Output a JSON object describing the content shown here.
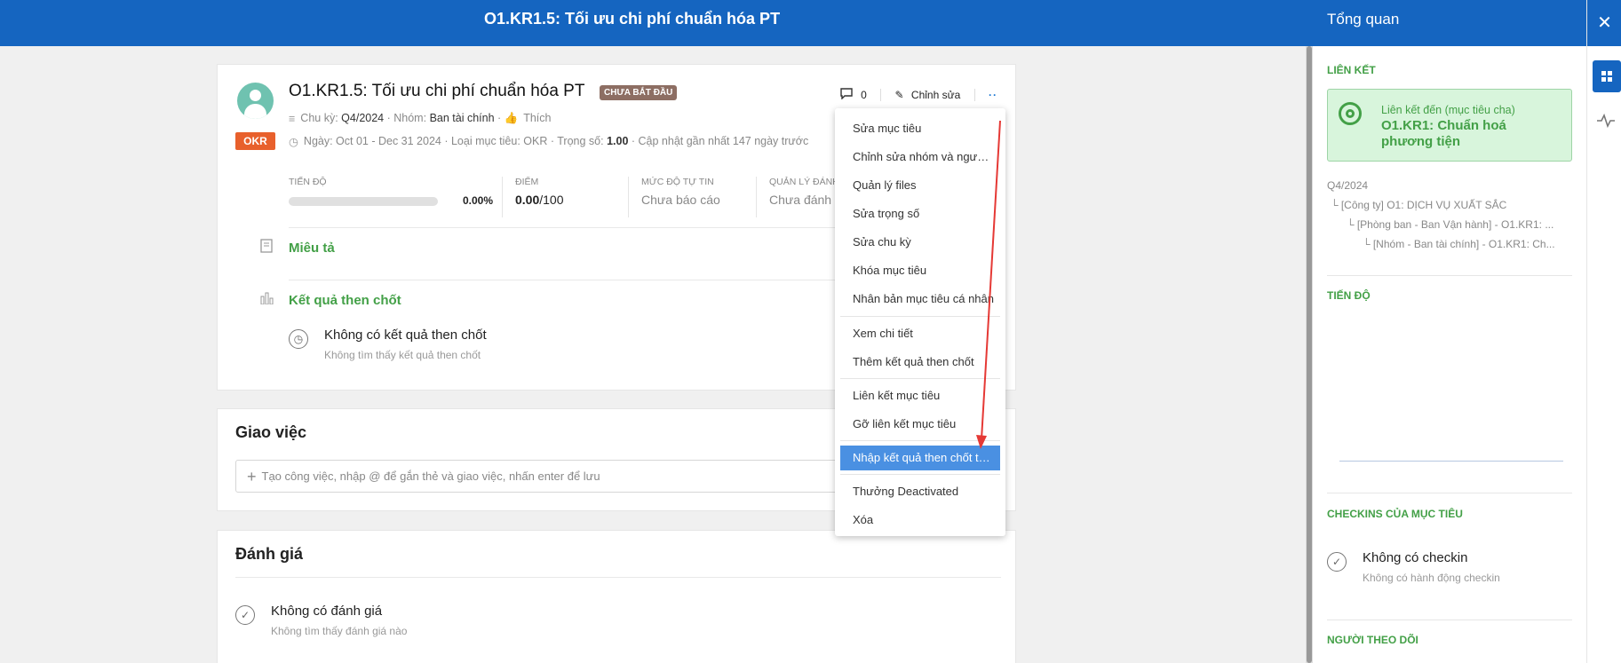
{
  "topbar": {
    "title": "O1.KR1.5: Tối ưu chi phí chuẩn hóa PT"
  },
  "objective": {
    "title": "O1.KR1.5: Tối ưu chi phí chuẩn hóa PT",
    "status": "CHƯA BẮT ĐẦU",
    "type_badge": "OKR",
    "cycle_label": "Chu kỳ:",
    "cycle_value": "Q4/2024",
    "group_label": "Nhóm:",
    "group_value": "Ban tài chính",
    "like_label": "Thích",
    "dates": "Ngày: Oct 01 - Dec 31 2024 · Loại mục tiêu: OKR · Trọng số:",
    "weight": "1.00",
    "updated": "· Cập nhật gần nhất 147 ngày trước"
  },
  "actions": {
    "comments_count": "0",
    "edit_label": "Chỉnh sửa",
    "more_label": "··"
  },
  "stats": {
    "progress_label": "TIẾN ĐỘ",
    "progress_value": "0.00%",
    "progress_fraction": 0,
    "score_label": "ĐIỂM",
    "score_value": "0.00",
    "score_total": "/100",
    "confidence_label": "MỨC ĐỘ TỰ TIN",
    "confidence_value": "Chưa báo cáo",
    "review_label": "QUẢN LÝ ĐÁNH GI",
    "review_value": "Chưa đánh giá"
  },
  "sections": {
    "description": "Miêu tả",
    "key_results": "Kết quả then chốt",
    "kr_empty_title": "Không có kết quả then chốt",
    "kr_empty_sub": "Không tìm thấy kết quả then chốt"
  },
  "tasks": {
    "title": "Giao việc",
    "placeholder": "Tạo công việc, nhập @ để gắn thẻ và giao việc, nhấn enter để lưu"
  },
  "reviews": {
    "title": "Đánh giá",
    "empty_title": "Không có đánh giá",
    "empty_sub": "Không tìm thấy đánh giá nào"
  },
  "menu": {
    "items": [
      "Sửa mục tiêu",
      "Chỉnh sửa nhóm và người sở hữu",
      "Quản lý files",
      "Sửa trọng số",
      "Sửa chu kỳ",
      "Khóa mục tiêu",
      "Nhân bản mục tiêu cá nhân",
      "Xem chi tiết",
      "Thêm kết quả then chốt",
      "Liên kết mục tiêu",
      "Gỡ liên kết mục tiêu",
      "Nhập kết quả then chốt từ file",
      "Thưởng Deactivated",
      "Xóa"
    ]
  },
  "overview": {
    "title": "Tổng quan",
    "link_section": "LIÊN KẾT",
    "link_to": "Liên kết đến (mục tiêu cha)",
    "parent": "O1.KR1: Chuẩn hoá phương tiện",
    "tree_cycle": "Q4/2024",
    "tree_1": "[Công ty] O1: DỊCH VỤ XUẤT SẮC",
    "tree_2": "[Phòng ban - Ban Vận hành] - O1.KR1: ...",
    "tree_3": "[Nhóm - Ban tài chính] - O1.KR1: Ch...",
    "progress_section": "TIẾN ĐỘ",
    "checkins_section": "CHECKINS CỦA MỤC TIÊU",
    "checkins_empty": "Không có checkin",
    "checkins_empty_sub": "Không có hành động checkin",
    "followers_section": "NGƯỜI THEO DÕI"
  },
  "colors": {
    "primary": "#1565c0",
    "green": "#43a047",
    "badge_okr": "#e8602c",
    "menu_active": "#4a90e2",
    "arrow": "#e53935"
  }
}
